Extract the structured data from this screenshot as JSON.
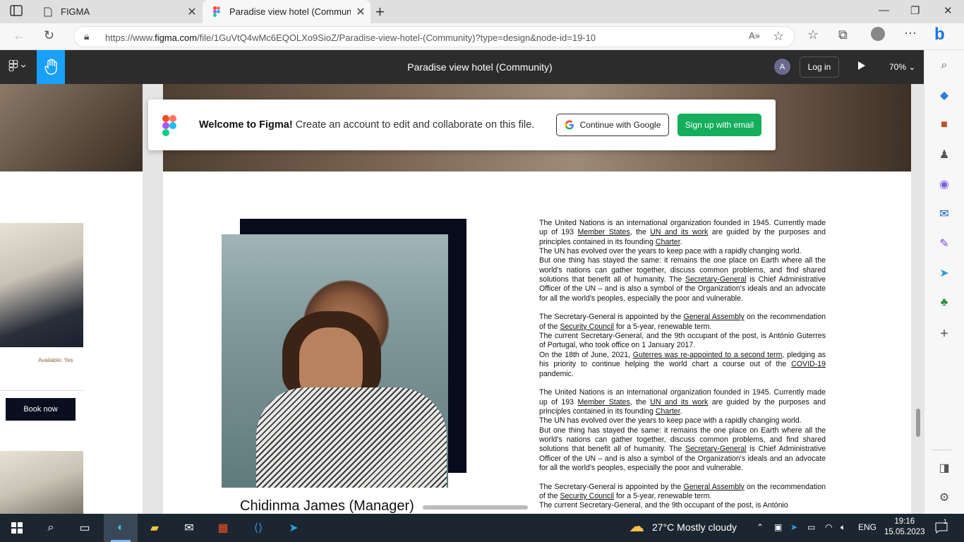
{
  "browser": {
    "tabs": [
      {
        "title": "FIGMA"
      },
      {
        "title": "Paradise view hotel (Community)"
      }
    ],
    "url_prefix": "https://www.",
    "url_host": "figma.com",
    "url_path": "/file/1GuVtQ4wMc6EQOLXo9SioZ/Paradise-view-hotel-(Community)?type=design&node-id=19-10"
  },
  "figma": {
    "file_title": "Paradise view hotel (Community)",
    "avatar_letter": "A",
    "login_label": "Log in",
    "zoom_label": "70%"
  },
  "welcome": {
    "bold": "Welcome to Figma!",
    "text": " Create an account to edit and collaborate on this file.",
    "google_label": "Continue with Google",
    "email_label": "Sign up with email"
  },
  "room_card": {
    "available": "Available: Yes",
    "book_label": "Book now"
  },
  "manager": {
    "name": "Chidinma James (Manager)"
  },
  "article": {
    "p1_a": "The United Nations is an international organization founded in 1945. Currently made up of 193 ",
    "p1_link1": "Member States",
    "p1_b": ", the ",
    "p1_link2": "UN and its work",
    "p1_c": " are guided by the purposes and principles contained in its founding ",
    "p1_link3": "Charter",
    "p1_d": ".",
    "p2": "The UN has evolved over the years to keep pace with a rapidly changing world.",
    "p3_a": "But one thing has stayed the same: it remains the one place on Earth where all the world's nations can gather together, discuss common problems, and find shared solutions that benefit all of humanity. The ",
    "p3_link": "Secretary-General",
    "p3_b": " is Chief Administrative Officer of the UN – and is also a symbol of the Organization's ideals and an advocate for all the world's peoples, especially the poor and vulnerable.",
    "p4_a": "The Secretary-General is appointed by the ",
    "p4_link1": "General Assembly",
    "p4_b": " on the recommendation of the ",
    "p4_link2": "Security Council",
    "p4_c": " for a 5-year, renewable term.",
    "p5": "The current Secretary-General, and the 9th occupant of the post, is António Guterres of Portugal, who took office on 1 January 2017.",
    "p6_a": "On the 18th of June, 2021, ",
    "p6_link1": "Guterres was re-appointed to a second term",
    "p6_b": ", pledging as his priority to continue helping the world chart a course out of the ",
    "p6_link2": "COVID-19",
    "p6_c": " pandemic.",
    "p5b": "The current Secretary-General, and the 9th occupant of the post, is António"
  },
  "taskbar": {
    "weather": "27°C  Mostly cloudy",
    "lang": "ENG",
    "time": "19:16",
    "date": "15.05.2023",
    "notif": "1"
  }
}
